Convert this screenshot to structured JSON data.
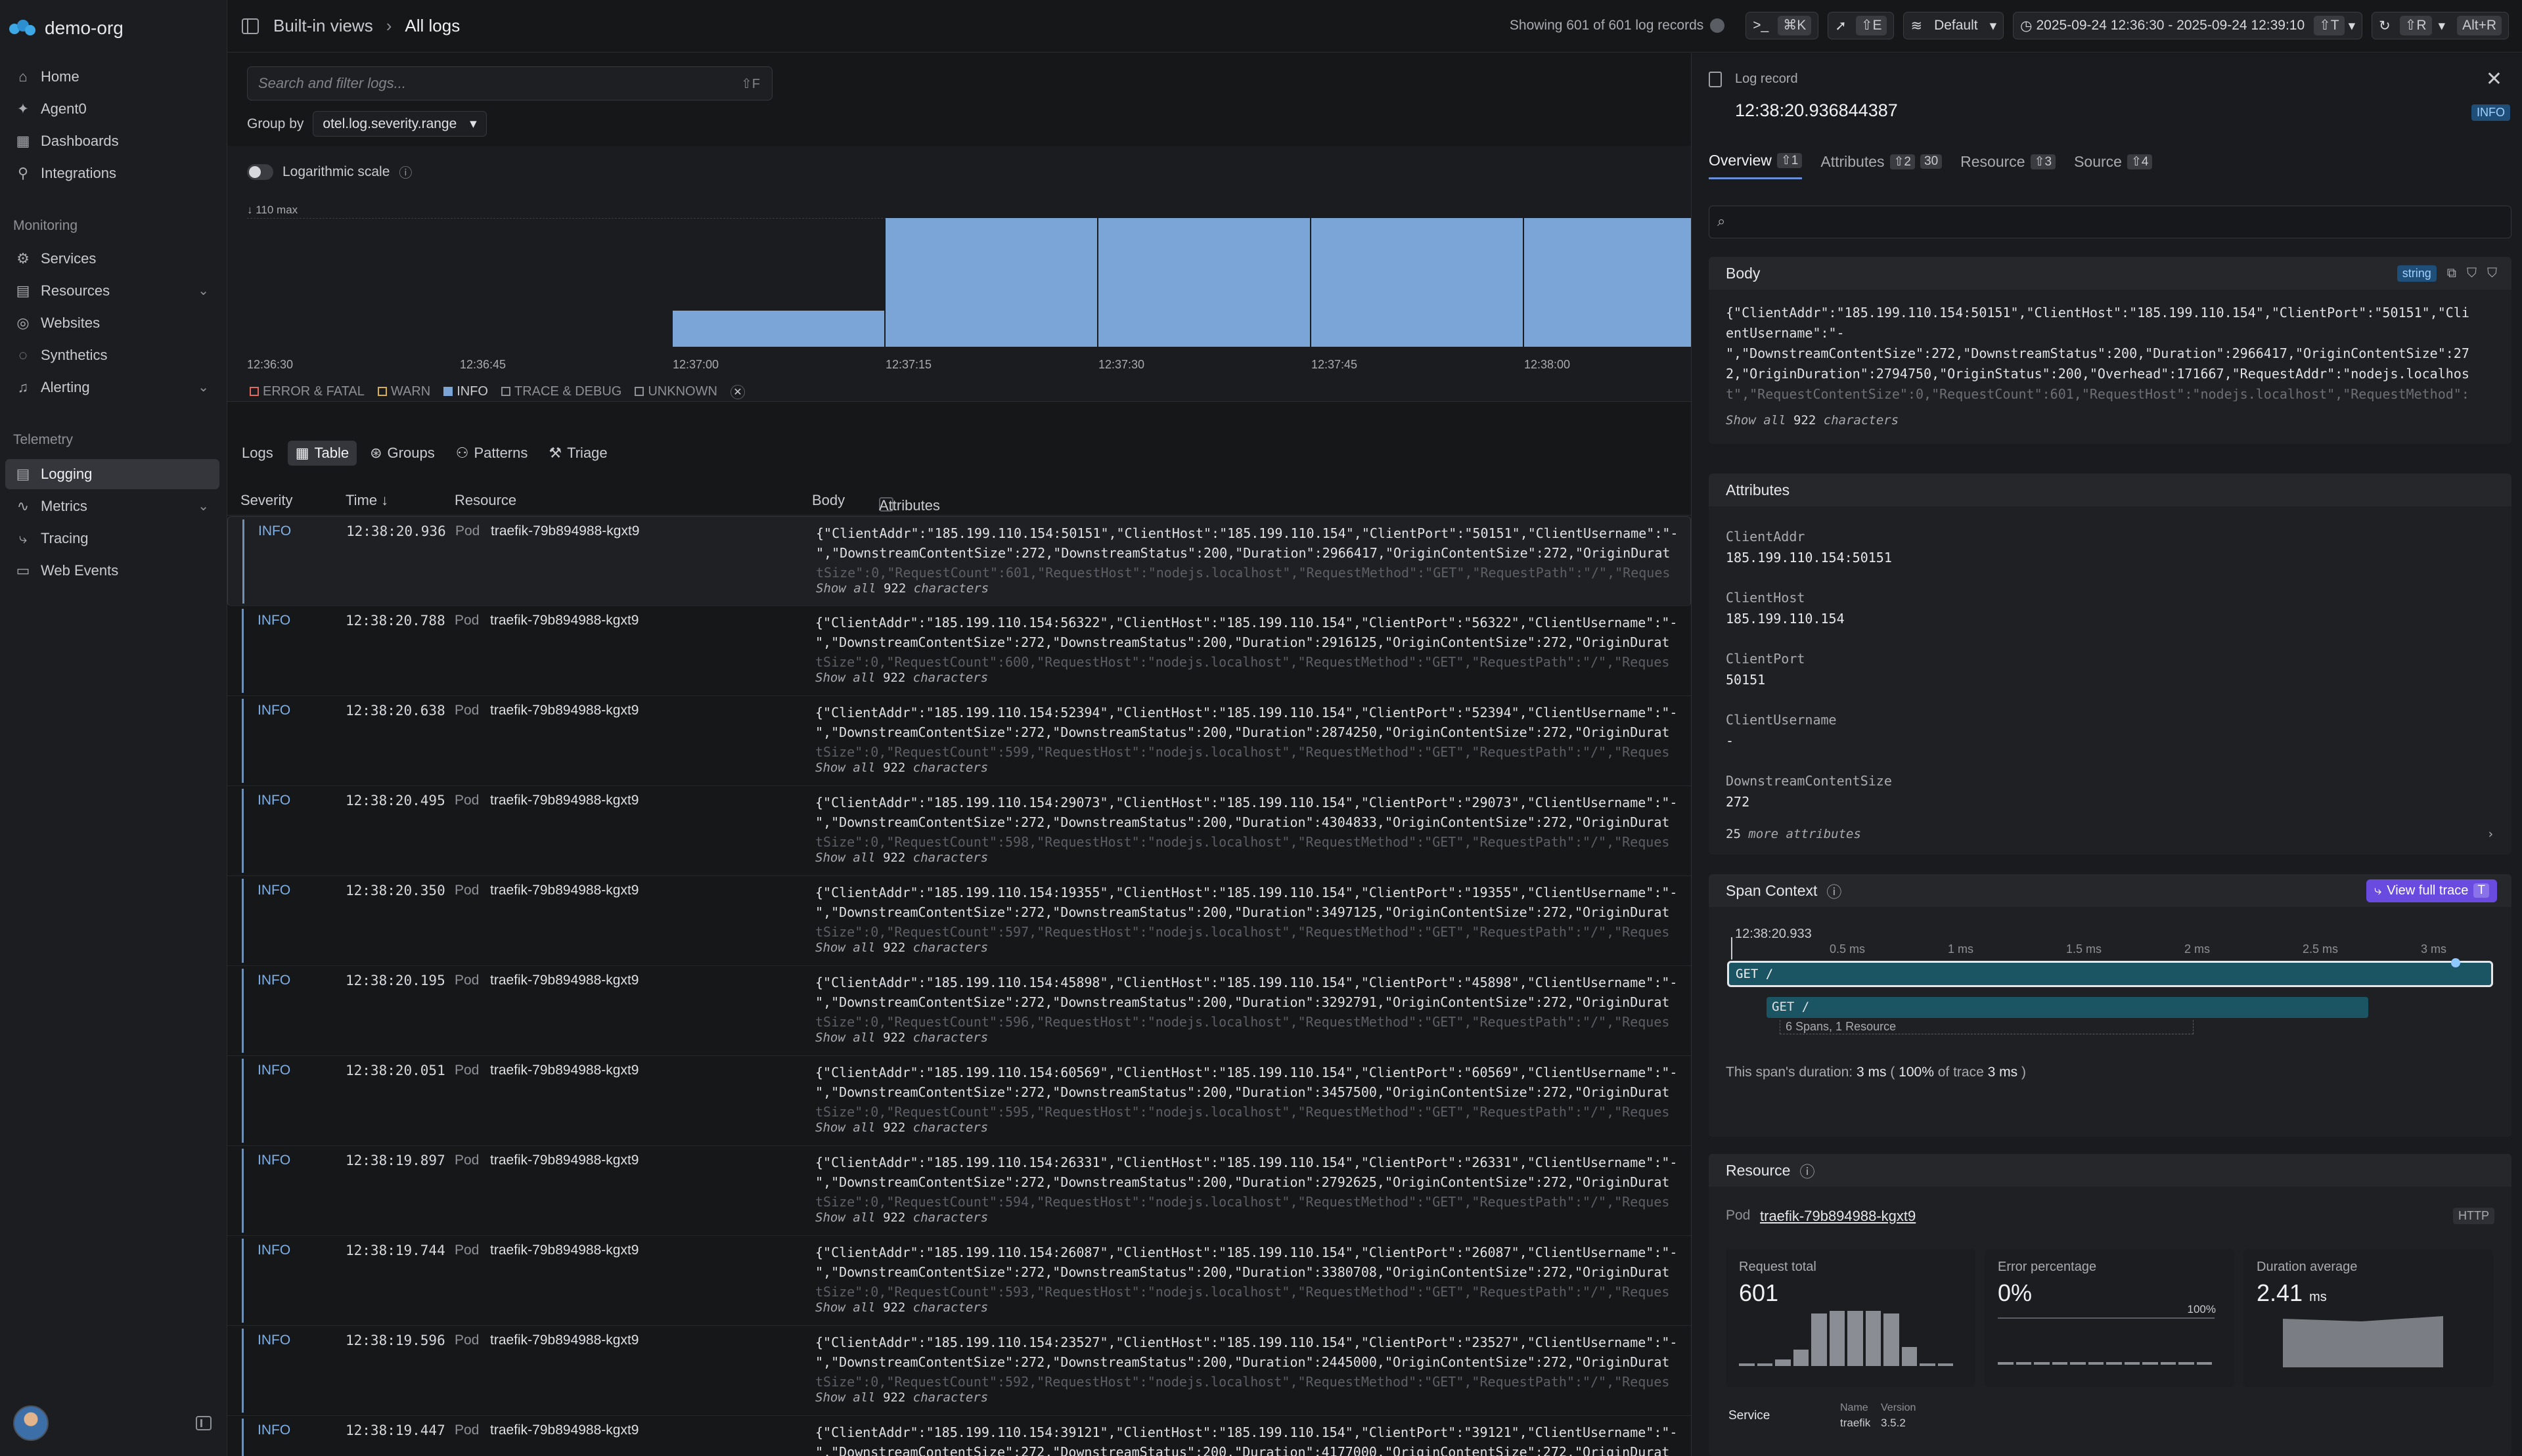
{
  "org": {
    "name": "demo-org"
  },
  "nav": {
    "items1": [
      {
        "label": "Home",
        "icon": "home-icon"
      },
      {
        "label": "Agent0",
        "icon": "sparkle-icon"
      },
      {
        "label": "Dashboards",
        "icon": "grid-icon"
      },
      {
        "label": "Integrations",
        "icon": "link-icon"
      }
    ],
    "monitoring_label": "Monitoring",
    "monitoring": [
      {
        "label": "Services"
      },
      {
        "label": "Resources"
      },
      {
        "label": "Websites"
      },
      {
        "label": "Synthetics"
      },
      {
        "label": "Alerting"
      }
    ],
    "telemetry_label": "Telemetry",
    "telemetry": [
      {
        "label": "Logging"
      },
      {
        "label": "Metrics"
      },
      {
        "label": "Tracing"
      },
      {
        "label": "Web Events"
      }
    ]
  },
  "topbar": {
    "crumb1": "Built-in views",
    "crumb2": "All logs",
    "showing": "Showing 601 of 601 log records",
    "cmd_kbd": "⌘K",
    "e_kbd": "⇧E",
    "default_label": "Default",
    "time_range": "2025-09-24 12:36:30 - 2025-09-24 12:39:10",
    "time_kbd": "⇧T",
    "refresh_kbd": "⇧R",
    "altr_kbd": "Alt+R"
  },
  "logs": {
    "search_placeholder": "Search and filter logs...",
    "search_kbd": "⇧F",
    "group_by_label": "Group by",
    "group_by_value": "otel.log.severity.range",
    "log_scale_label": "Logarithmic scale",
    "max_label": "110 max",
    "histogram": [
      0,
      0,
      28,
      100,
      100,
      100,
      100,
      100,
      100
    ],
    "xticks": [
      "12:36:30",
      "12:36:45",
      "12:37:00",
      "12:37:15",
      "12:37:30",
      "12:37:45",
      "12:38:00"
    ],
    "legend": [
      {
        "label": "ERROR & FATAL",
        "color": "#e0685f",
        "active": false
      },
      {
        "label": "WARN",
        "color": "#d7b04a",
        "active": false
      },
      {
        "label": "INFO",
        "color": "#7ba5d6",
        "active": true
      },
      {
        "label": "TRACE & DEBUG",
        "color": "#8d9096",
        "active": false
      },
      {
        "label": "UNKNOWN",
        "color": "#8d9096",
        "active": false
      }
    ],
    "tabs_label": "Logs",
    "tabs": [
      "Table",
      "Groups",
      "Patterns",
      "Triage"
    ],
    "columns": {
      "severity": "Severity",
      "time": "Time ↓",
      "resource": "Resource",
      "body": "Body",
      "attributes": "Attributes"
    },
    "pod_label": "Pod",
    "resource_name": "traefik-79b894988-kgxt9",
    "show_all_prefix": "Show all",
    "show_all_count": "922",
    "show_all_suffix": "characters",
    "rows": [
      {
        "sev": "INFO",
        "time": "12:38:20.936",
        "line1": "{\"ClientAddr\":\"185.199.110.154:50151\",\"ClientHost\":\"185.199.110.154\",\"ClientPort\":\"50151\",\"ClientUsername\":\"-",
        "line2": "\",\"DownstreamContentSize\":272,\"DownstreamStatus\":200,\"Duration\":2966417,\"OriginContentSize\":272,\"OriginDurat",
        "line3": "tSize\":0,\"RequestCount\":601,\"RequestHost\":\"nodejs.localhost\",\"RequestMethod\":\"GET\",\"RequestPath\":\"/\",\"Reques"
      },
      {
        "sev": "INFO",
        "time": "12:38:20.788",
        "line1": "{\"ClientAddr\":\"185.199.110.154:56322\",\"ClientHost\":\"185.199.110.154\",\"ClientPort\":\"56322\",\"ClientUsername\":\"-",
        "line2": "\",\"DownstreamContentSize\":272,\"DownstreamStatus\":200,\"Duration\":2916125,\"OriginContentSize\":272,\"OriginDurat",
        "line3": "tSize\":0,\"RequestCount\":600,\"RequestHost\":\"nodejs.localhost\",\"RequestMethod\":\"GET\",\"RequestPath\":\"/\",\"Reques"
      },
      {
        "sev": "INFO",
        "time": "12:38:20.638",
        "line1": "{\"ClientAddr\":\"185.199.110.154:52394\",\"ClientHost\":\"185.199.110.154\",\"ClientPort\":\"52394\",\"ClientUsername\":\"-",
        "line2": "\",\"DownstreamContentSize\":272,\"DownstreamStatus\":200,\"Duration\":2874250,\"OriginContentSize\":272,\"OriginDurat",
        "line3": "tSize\":0,\"RequestCount\":599,\"RequestHost\":\"nodejs.localhost\",\"RequestMethod\":\"GET\",\"RequestPath\":\"/\",\"Reques"
      },
      {
        "sev": "INFO",
        "time": "12:38:20.495",
        "line1": "{\"ClientAddr\":\"185.199.110.154:29073\",\"ClientHost\":\"185.199.110.154\",\"ClientPort\":\"29073\",\"ClientUsername\":\"-",
        "line2": "\",\"DownstreamContentSize\":272,\"DownstreamStatus\":200,\"Duration\":4304833,\"OriginContentSize\":272,\"OriginDurat",
        "line3": "tSize\":0,\"RequestCount\":598,\"RequestHost\":\"nodejs.localhost\",\"RequestMethod\":\"GET\",\"RequestPath\":\"/\",\"Reques"
      },
      {
        "sev": "INFO",
        "time": "12:38:20.350",
        "line1": "{\"ClientAddr\":\"185.199.110.154:19355\",\"ClientHost\":\"185.199.110.154\",\"ClientPort\":\"19355\",\"ClientUsername\":\"-",
        "line2": "\",\"DownstreamContentSize\":272,\"DownstreamStatus\":200,\"Duration\":3497125,\"OriginContentSize\":272,\"OriginDurat",
        "line3": "tSize\":0,\"RequestCount\":597,\"RequestHost\":\"nodejs.localhost\",\"RequestMethod\":\"GET\",\"RequestPath\":\"/\",\"Reques"
      },
      {
        "sev": "INFO",
        "time": "12:38:20.195",
        "line1": "{\"ClientAddr\":\"185.199.110.154:45898\",\"ClientHost\":\"185.199.110.154\",\"ClientPort\":\"45898\",\"ClientUsername\":\"-",
        "line2": "\",\"DownstreamContentSize\":272,\"DownstreamStatus\":200,\"Duration\":3292791,\"OriginContentSize\":272,\"OriginDurat",
        "line3": "tSize\":0,\"RequestCount\":596,\"RequestHost\":\"nodejs.localhost\",\"RequestMethod\":\"GET\",\"RequestPath\":\"/\",\"Reques"
      },
      {
        "sev": "INFO",
        "time": "12:38:20.051",
        "line1": "{\"ClientAddr\":\"185.199.110.154:60569\",\"ClientHost\":\"185.199.110.154\",\"ClientPort\":\"60569\",\"ClientUsername\":\"-",
        "line2": "\",\"DownstreamContentSize\":272,\"DownstreamStatus\":200,\"Duration\":3457500,\"OriginContentSize\":272,\"OriginDurat",
        "line3": "tSize\":0,\"RequestCount\":595,\"RequestHost\":\"nodejs.localhost\",\"RequestMethod\":\"GET\",\"RequestPath\":\"/\",\"Reques"
      },
      {
        "sev": "INFO",
        "time": "12:38:19.897",
        "line1": "{\"ClientAddr\":\"185.199.110.154:26331\",\"ClientHost\":\"185.199.110.154\",\"ClientPort\":\"26331\",\"ClientUsername\":\"-",
        "line2": "\",\"DownstreamContentSize\":272,\"DownstreamStatus\":200,\"Duration\":2792625,\"OriginContentSize\":272,\"OriginDurat",
        "line3": "tSize\":0,\"RequestCount\":594,\"RequestHost\":\"nodejs.localhost\",\"RequestMethod\":\"GET\",\"RequestPath\":\"/\",\"Reques"
      },
      {
        "sev": "INFO",
        "time": "12:38:19.744",
        "line1": "{\"ClientAddr\":\"185.199.110.154:26087\",\"ClientHost\":\"185.199.110.154\",\"ClientPort\":\"26087\",\"ClientUsername\":\"-",
        "line2": "\",\"DownstreamContentSize\":272,\"DownstreamStatus\":200,\"Duration\":3380708,\"OriginContentSize\":272,\"OriginDurat",
        "line3": "tSize\":0,\"RequestCount\":593,\"RequestHost\":\"nodejs.localhost\",\"RequestMethod\":\"GET\",\"RequestPath\":\"/\",\"Reques"
      },
      {
        "sev": "INFO",
        "time": "12:38:19.596",
        "line1": "{\"ClientAddr\":\"185.199.110.154:23527\",\"ClientHost\":\"185.199.110.154\",\"ClientPort\":\"23527\",\"ClientUsername\":\"-",
        "line2": "\",\"DownstreamContentSize\":272,\"DownstreamStatus\":200,\"Duration\":2445000,\"OriginContentSize\":272,\"OriginDurat",
        "line3": "tSize\":0,\"RequestCount\":592,\"RequestHost\":\"nodejs.localhost\",\"RequestMethod\":\"GET\",\"RequestPath\":\"/\",\"Reques"
      },
      {
        "sev": "INFO",
        "time": "12:38:19.447",
        "line1": "{\"ClientAddr\":\"185.199.110.154:39121\",\"ClientHost\":\"185.199.110.154\",\"ClientPort\":\"39121\",\"ClientUsername\":\"-",
        "line2": "\",\"DownstreamContentSize\":272,\"DownstreamStatus\":200,\"Duration\":4177000,\"OriginContentSize\":272,\"OriginDurat",
        "line3": ""
      }
    ]
  },
  "panel": {
    "label": "Log record",
    "time": "12:38:20.936844387",
    "badge": "INFO",
    "tabs": [
      {
        "label": "Overview",
        "kbd": "⇧1"
      },
      {
        "label": "Attributes",
        "kbd": "⇧2",
        "count": "30"
      },
      {
        "label": "Resource",
        "kbd": "⇧3"
      },
      {
        "label": "Source",
        "kbd": "⇧4"
      }
    ],
    "body_title": "Body",
    "body_type": "string",
    "body_lines": [
      "{\"ClientAddr\":\"185.199.110.154:50151\",\"ClientHost\":\"185.199.110.154\",\"ClientPort\":\"50151\",\"Cli",
      "entUsername\":\"-",
      "\",\"DownstreamContentSize\":272,\"DownstreamStatus\":200,\"Duration\":2966417,\"OriginContentSize\":27",
      "2,\"OriginDuration\":2794750,\"OriginStatus\":200,\"Overhead\":171667,\"RequestAddr\":\"nodejs.localhos",
      "t\",\"RequestContentSize\":0,\"RequestCount\":601,\"RequestHost\":\"nodejs.localhost\",\"RequestMethod\":"
    ],
    "show_all": "Show all",
    "show_all_count": "922",
    "show_all_suffix": "characters",
    "attributes_title": "Attributes",
    "attributes": [
      {
        "key": "ClientAddr",
        "value": "185.199.110.154:50151"
      },
      {
        "key": "ClientHost",
        "value": "185.199.110.154"
      },
      {
        "key": "ClientPort",
        "value": "50151"
      },
      {
        "key": "ClientUsername",
        "value": "-"
      },
      {
        "key": "DownstreamContentSize",
        "value": "272"
      }
    ],
    "more_attrs_count": "25",
    "more_attrs_label": "more attributes",
    "span_title": "Span Context",
    "view_trace": "View full trace",
    "view_trace_kbd": "T",
    "span_start": "12:38:20.933",
    "span_ticks": [
      "0.5 ms",
      "1 ms",
      "1.5 ms",
      "2 ms",
      "2.5 ms",
      "3 ms"
    ],
    "span_main": "GET /",
    "span_child": "GET /",
    "span_summary": "6 Spans, 1 Resource",
    "duration_prefix": "This span's duration:",
    "duration_value": "3 ms",
    "duration_pct": "100%",
    "duration_of": "of trace",
    "duration_trace": "3 ms",
    "resource_title": "Resource",
    "resource_type": "Pod",
    "resource_name": "traefik-79b894988-kgxt9",
    "resource_tag": "HTTP",
    "metrics": [
      {
        "title": "Request total",
        "value": "601",
        "unit": ""
      },
      {
        "title": "Error percentage",
        "value": "0%",
        "unit": "",
        "max": "100%"
      },
      {
        "title": "Duration average",
        "value": "2.41",
        "unit": "ms"
      }
    ],
    "request_bars": [
      5,
      5,
      12,
      30,
      95,
      100,
      100,
      100,
      95,
      35,
      5,
      5
    ],
    "service_label": "Service",
    "name_label": "Name",
    "version_label": "Version",
    "service_name": "traefik",
    "service_version": "3.5.2"
  }
}
